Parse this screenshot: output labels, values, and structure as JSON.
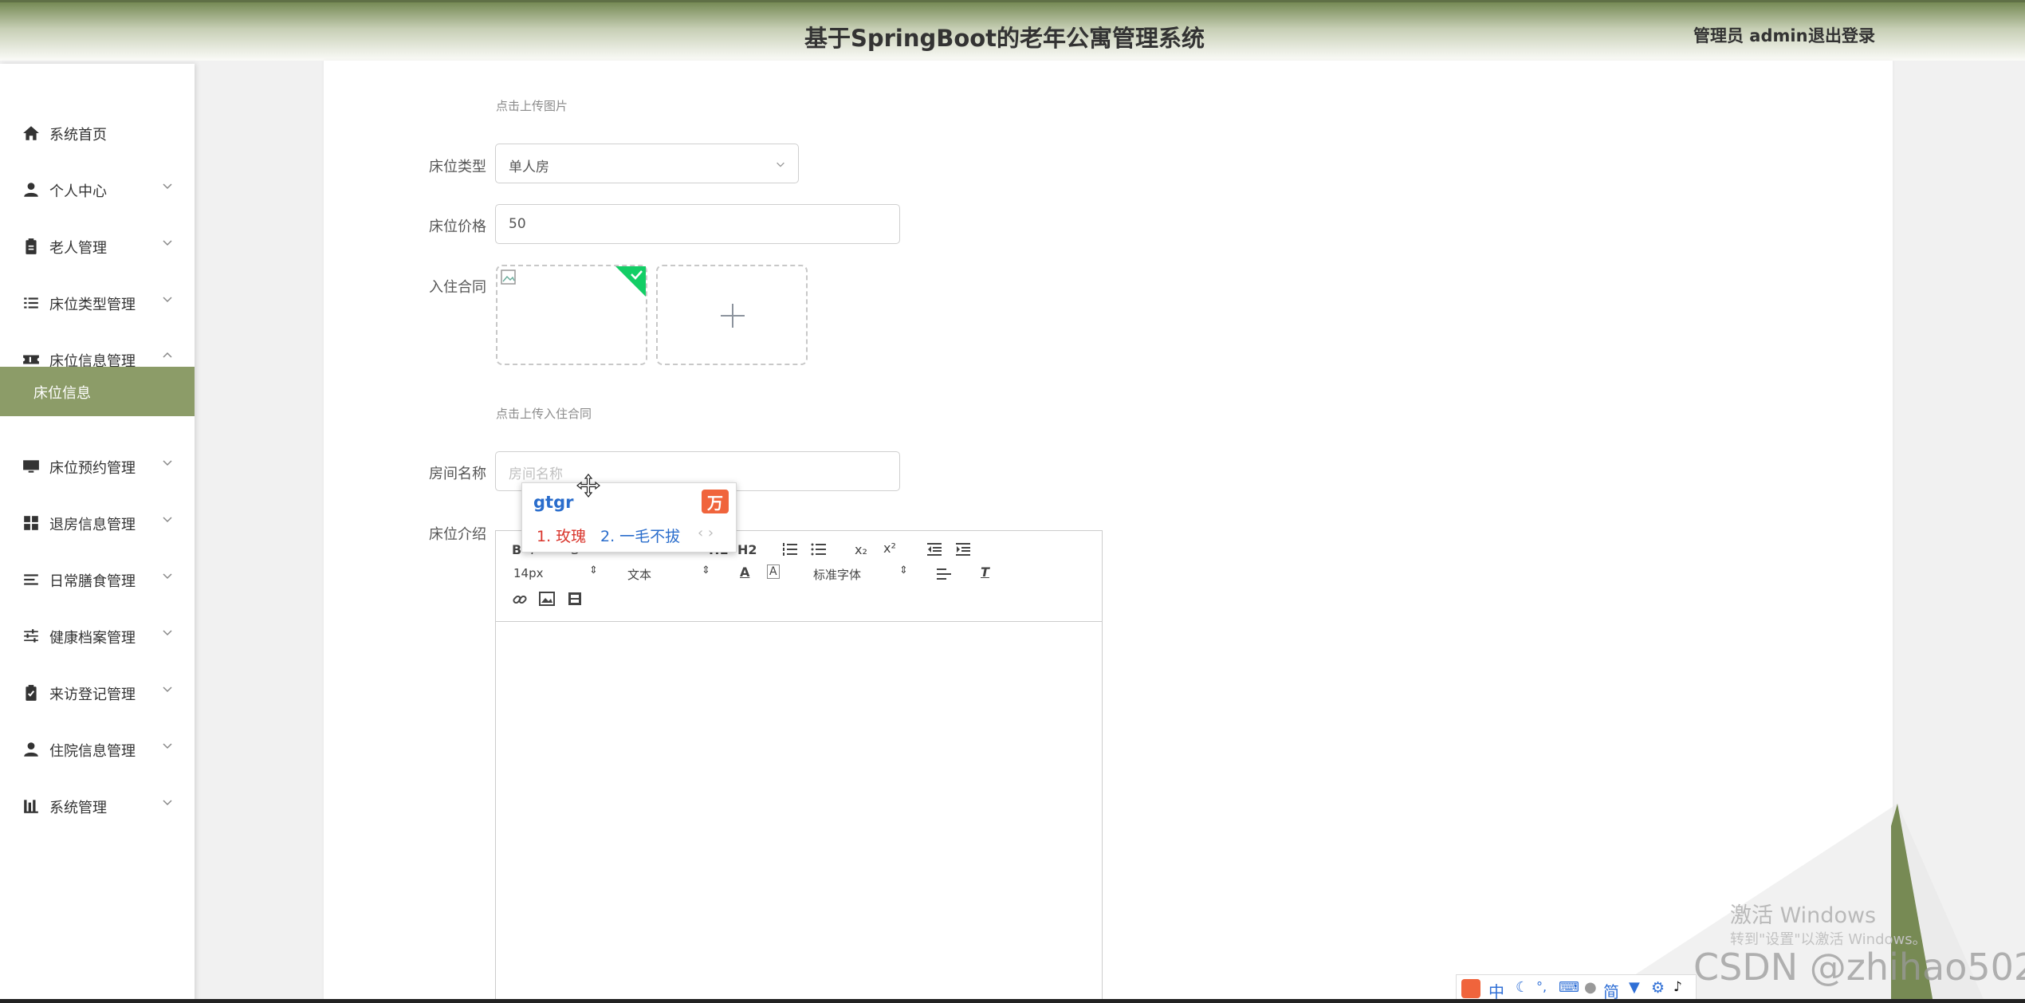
{
  "header": {
    "title": "基于SpringBoot的老年公寓管理系统",
    "user_label": "管理员 admin",
    "logout_label": "退出登录"
  },
  "sidebar": {
    "items": [
      {
        "label": "系统首页",
        "icon": "home-icon"
      },
      {
        "label": "个人中心",
        "icon": "user-icon"
      },
      {
        "label": "老人管理",
        "icon": "clipboard-icon"
      },
      {
        "label": "床位类型管理",
        "icon": "list-icon"
      },
      {
        "label": "床位信息管理",
        "icon": "ticket-icon"
      },
      {
        "label": "床位预约管理",
        "icon": "monitor-icon"
      },
      {
        "label": "退房信息管理",
        "icon": "grid-icon"
      },
      {
        "label": "日常膳食管理",
        "icon": "align-icon"
      },
      {
        "label": "健康档案管理",
        "icon": "sliders-icon"
      },
      {
        "label": "来访登记管理",
        "icon": "clipboard-check-icon"
      },
      {
        "label": "住院信息管理",
        "icon": "user-icon"
      },
      {
        "label": "系统管理",
        "icon": "chart-icon"
      }
    ],
    "active_subitem": "床位信息",
    "active_color": "#8c9c68"
  },
  "form": {
    "upload_image_hint": "点击上传图片",
    "bed_type_label": "床位类型",
    "bed_type_value": "单人房",
    "bed_price_label": "床位价格",
    "bed_price_value": "50",
    "contract_label": "入住合同",
    "upload_contract_hint": "点击上传入住合同",
    "room_name_label": "房间名称",
    "room_name_placeholder": "房间名称",
    "bed_intro_label": "床位介绍"
  },
  "editor": {
    "font_size": "14px",
    "text_style": "文本",
    "font_family": "标准字体",
    "h1": "H1",
    "h2": "H2",
    "sub": "x₂",
    "sup": "x²"
  },
  "ime": {
    "input": "gtgr",
    "candidate_1": "1. 玫瑰",
    "candidate_2": "2. 一毛不拔",
    "nav": "‹ ›"
  },
  "tray": {
    "chinese": "中",
    "simplified": "简"
  },
  "overlay": {
    "activate_title": "激活 Windows",
    "activate_sub": "转到\"设置\"以激活 Windows。",
    "watermark": "CSDN @zhihao502"
  }
}
